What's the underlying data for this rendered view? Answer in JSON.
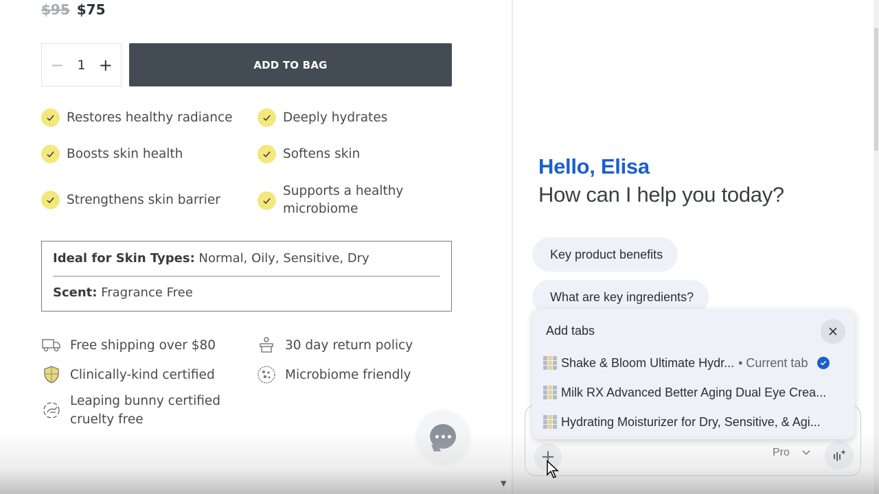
{
  "product": {
    "price_old": "$95",
    "price_new": "$75",
    "quantity": "1",
    "qty_minus": "−",
    "qty_plus": "+",
    "add_to_bag": "ADD TO BAG",
    "benefits": [
      "Restores healthy radiance",
      "Deeply hydrates",
      "Boosts skin health",
      "Softens skin",
      "Strengthens skin barrier",
      "Supports a healthy microbiome"
    ],
    "skin_types_label": "Ideal for Skin Types:",
    "skin_types_value": "Normal, Oily, Sensitive, Dry",
    "scent_label": "Scent:",
    "scent_value": "Fragrance Free",
    "features": [
      {
        "icon": "truck-icon",
        "label": "Free shipping over $80"
      },
      {
        "icon": "return-box-icon",
        "label": "30 day return policy"
      },
      {
        "icon": "shield-icon",
        "label": "Clinically-kind certified"
      },
      {
        "icon": "microbiome-icon",
        "label": "Microbiome friendly"
      },
      {
        "icon": "bunny-icon",
        "label": "Leaping bunny certified cruelty free"
      }
    ],
    "chat_icon": "chat-bubble-icon"
  },
  "assistant": {
    "greeting": "Hello, Elisa",
    "subtitle": "How can I help you today?",
    "suggestions": [
      "Key product benefits",
      "What are key ingredients?"
    ],
    "add_tabs": {
      "title": "Add tabs",
      "close_icon": "close-icon",
      "tabs": [
        {
          "title": "Shake & Bloom Ultimate Hydr...",
          "suffix": "• Current tab",
          "selected": true
        },
        {
          "title": "Milk RX Advanced Better Aging Dual Eye Crea...",
          "suffix": "",
          "selected": false
        },
        {
          "title": "Hydrating Moisturizer for Dry, Sensitive, & Agi...",
          "suffix": "",
          "selected": false
        }
      ]
    },
    "composer": {
      "add_label": "+",
      "model": "Pro",
      "voice_icon": "voice-sparkle-icon"
    }
  },
  "colors": {
    "accent_blue": "#1a5fd0",
    "check_yellow": "#f3e87d",
    "button_dark": "#434c55",
    "chip_bg": "#eef2f8"
  }
}
